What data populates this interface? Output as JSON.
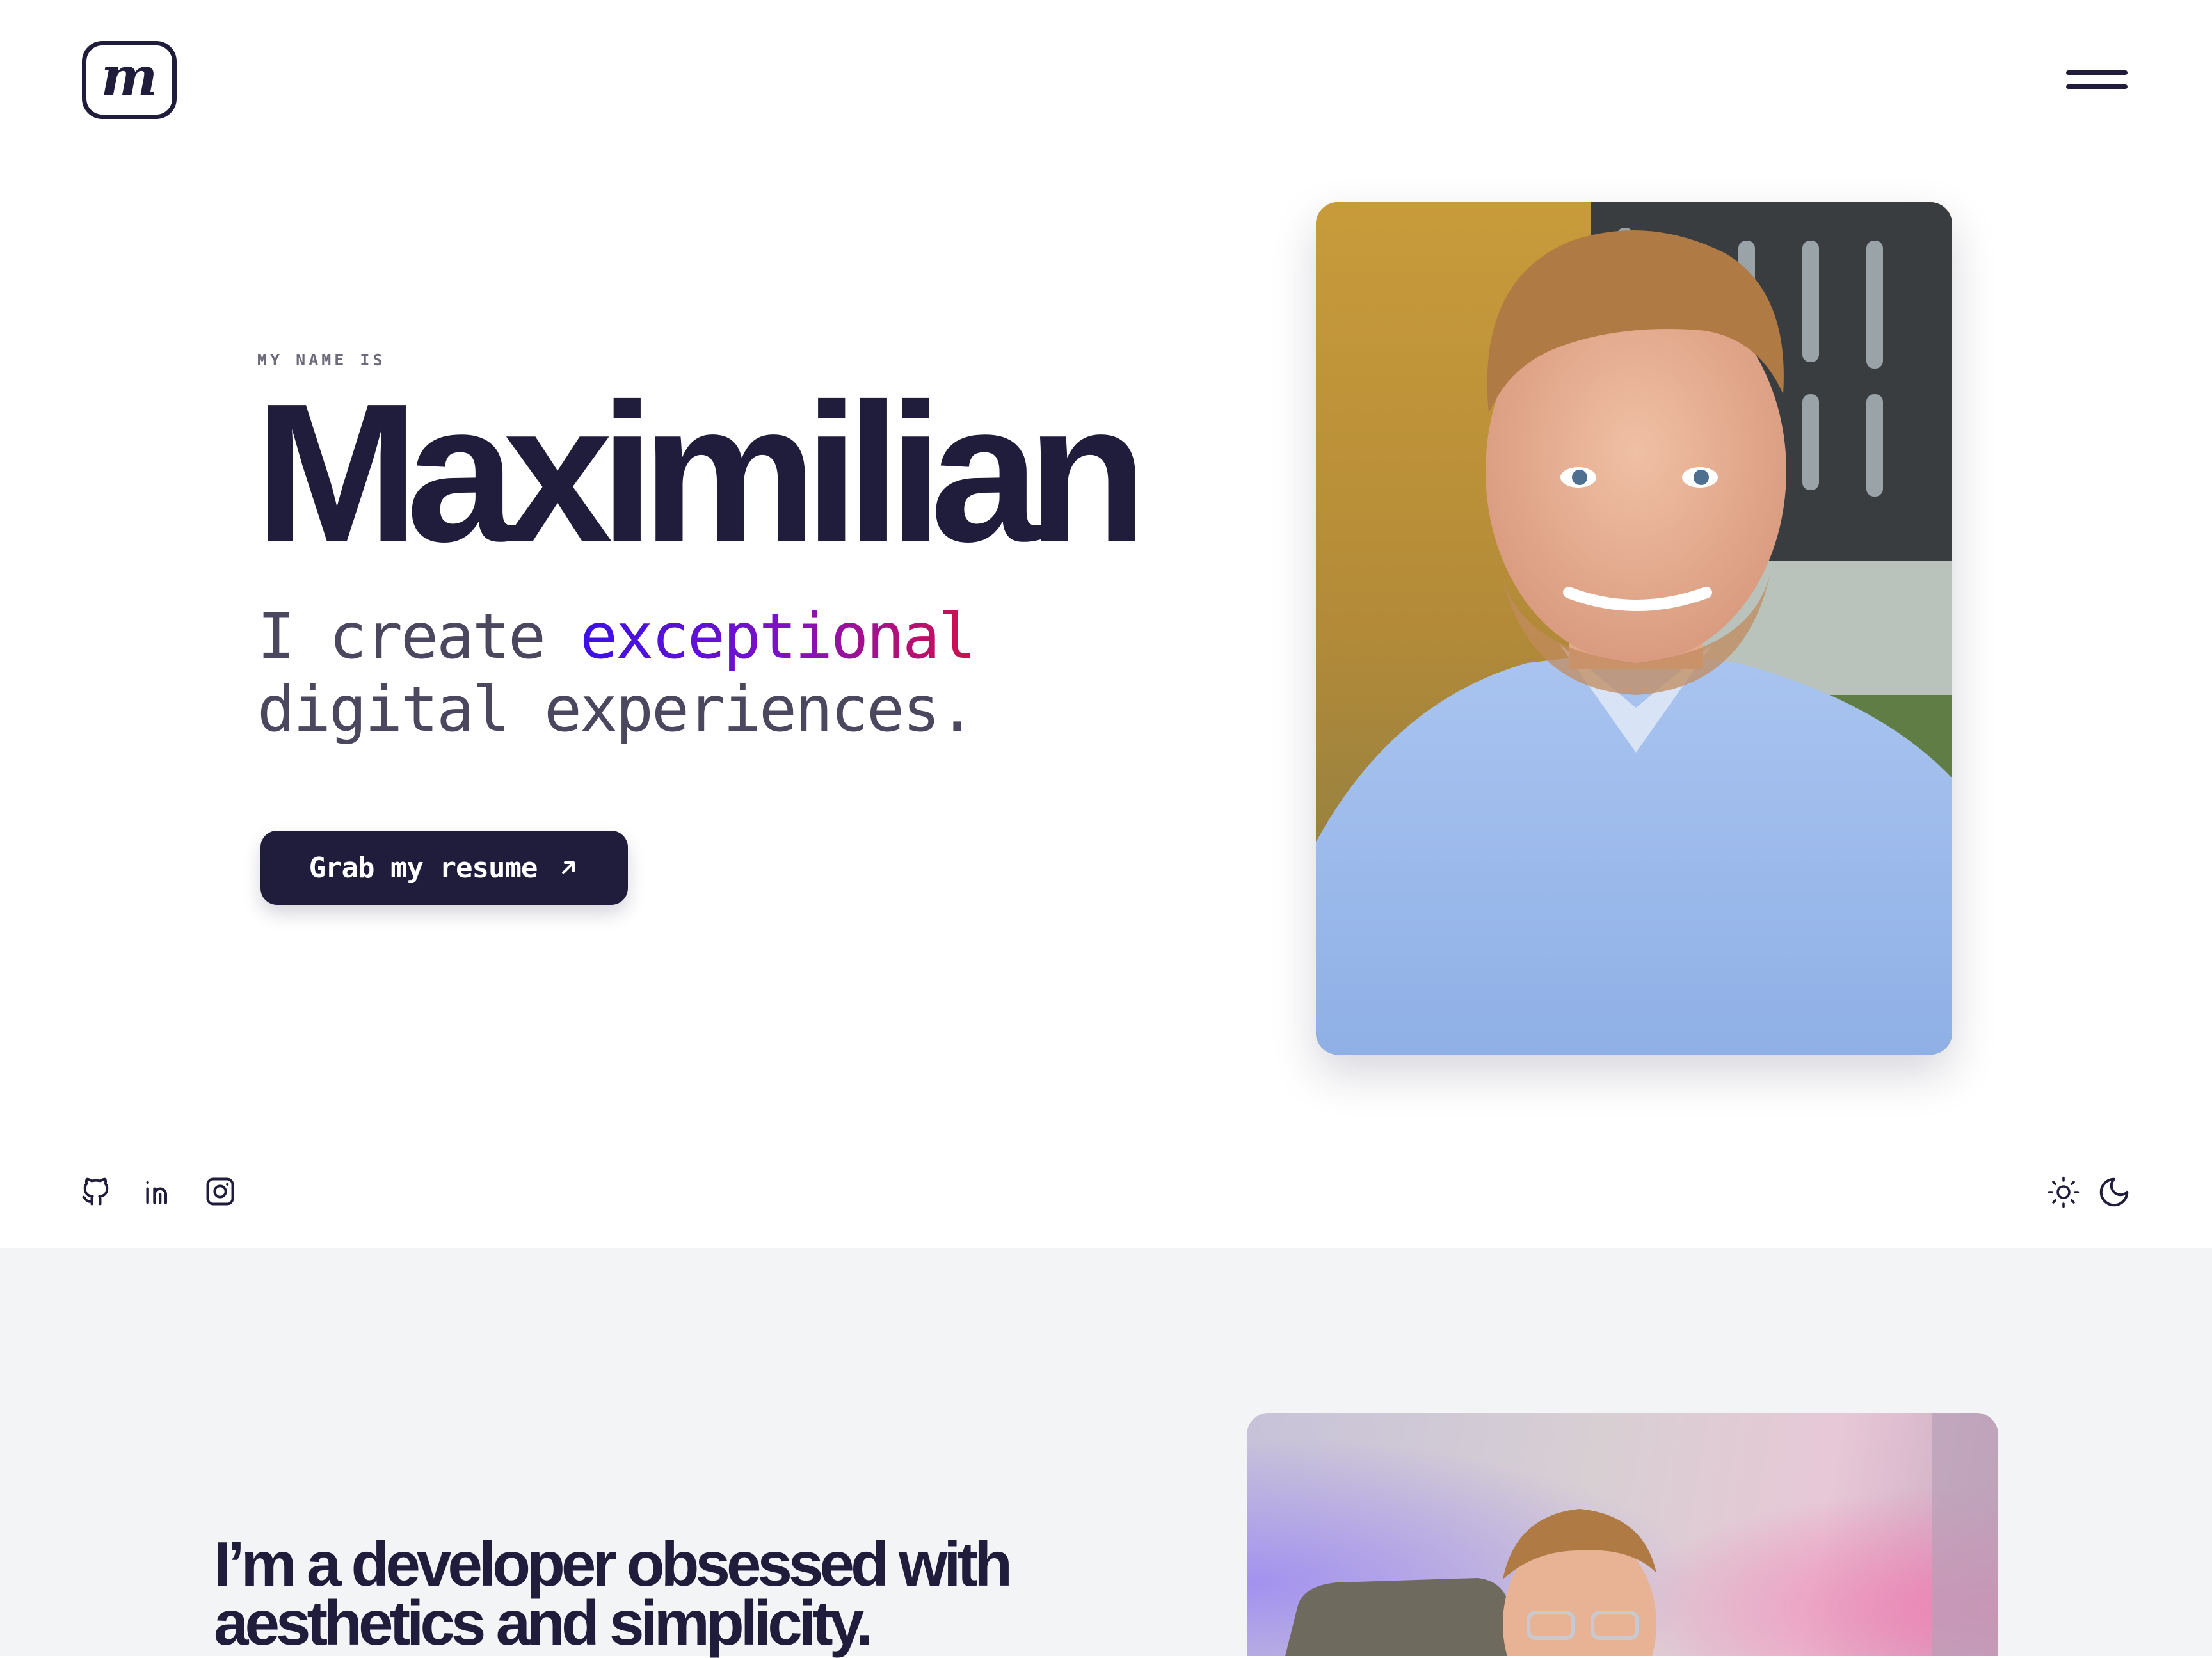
{
  "header": {
    "logo_letter": "m",
    "logo_icon": "logo-m-icon",
    "menu_icon": "hamburger-menu-icon"
  },
  "hero": {
    "eyebrow": "MY NAME IS",
    "name": "Maximilian",
    "tagline_prefix": "I create ",
    "tagline_accent": "exceptional",
    "tagline_suffix": "digital experiences.",
    "resume_button_label": "Grab my resume",
    "resume_button_icon": "arrow-up-right-icon",
    "photo_alt": "Portrait of Maximilian in a light blue shirt"
  },
  "social_links": [
    {
      "name": "github-icon"
    },
    {
      "name": "linkedin-icon"
    },
    {
      "name": "instagram-icon"
    }
  ],
  "theme_toggle": {
    "light_icon": "sun-icon",
    "dark_icon": "moon-icon"
  },
  "about": {
    "heading": "I’m a developer obsessed with aesthetics and simplicity.",
    "photo_alt": "Maximilian sitting in a chair with glasses"
  },
  "colors": {
    "ink": "#201c3c",
    "muted": "#4a475e",
    "accent_start": "#3a10e8",
    "accent_end": "#d0104a",
    "section_bg": "#f3f4f6"
  }
}
